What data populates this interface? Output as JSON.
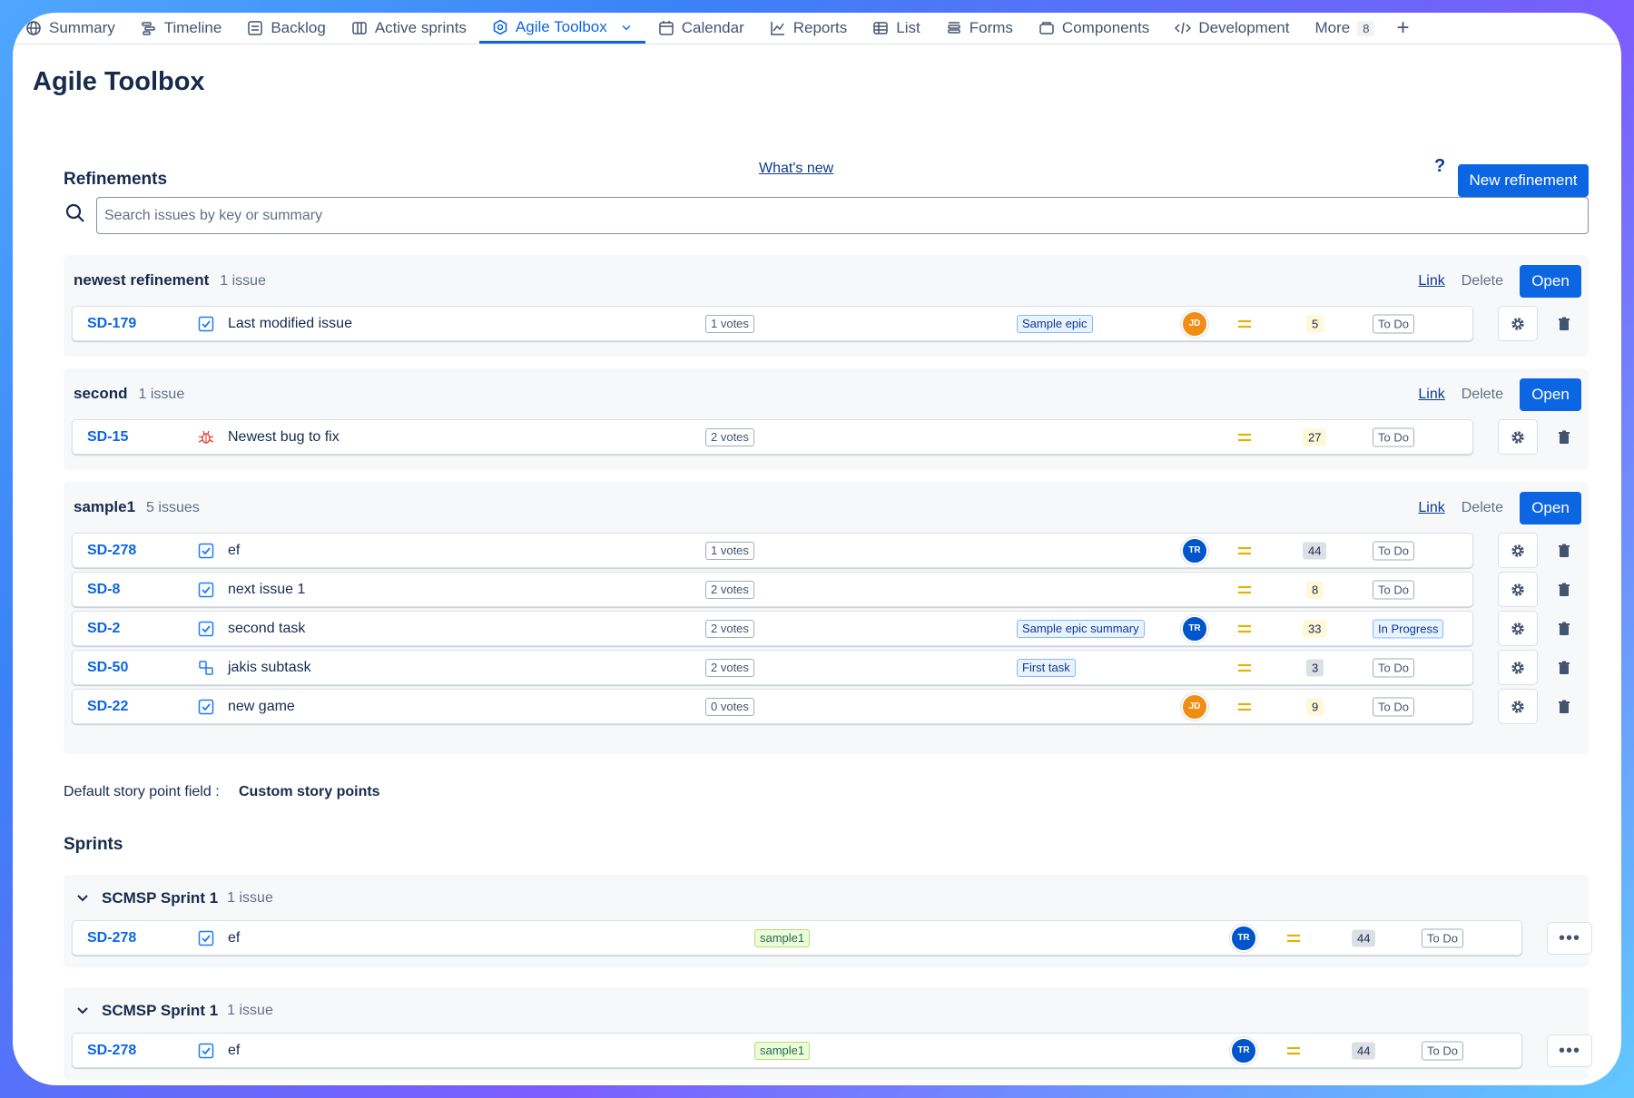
{
  "nav": {
    "tabs": [
      {
        "label": "Summary",
        "icon": "globe-icon"
      },
      {
        "label": "Timeline",
        "icon": "timeline-icon"
      },
      {
        "label": "Backlog",
        "icon": "backlog-icon"
      },
      {
        "label": "Active sprints",
        "icon": "board-icon"
      },
      {
        "label": "Agile Toolbox",
        "icon": "hexagon-icon",
        "active": true
      },
      {
        "label": "Calendar",
        "icon": "calendar-icon"
      },
      {
        "label": "Reports",
        "icon": "chart-icon"
      },
      {
        "label": "List",
        "icon": "list-icon"
      },
      {
        "label": "Forms",
        "icon": "forms-icon"
      },
      {
        "label": "Components",
        "icon": "components-icon"
      },
      {
        "label": "Development",
        "icon": "code-icon"
      }
    ],
    "more_label": "More",
    "more_count": "8",
    "add_label": "+"
  },
  "page": {
    "title": "Agile Toolbox"
  },
  "refinements": {
    "title": "Refinements",
    "whats_new": "What's new",
    "help": "?",
    "new_button": "New refinement",
    "search_placeholder": "Search issues by key or summary",
    "actions": {
      "link": "Link",
      "delete": "Delete",
      "open": "Open"
    },
    "groups": [
      {
        "name": "newest refinement",
        "count": "1 issue",
        "issues": [
          {
            "key": "SD-179",
            "type": "task",
            "summary": "Last modified issue",
            "votes": "1 votes",
            "epic": "Sample epic",
            "avatar": "JD",
            "points": "5",
            "status": "To Do"
          }
        ]
      },
      {
        "name": "second",
        "count": "1 issue",
        "issues": [
          {
            "key": "SD-15",
            "type": "bug",
            "summary": "Newest bug to fix",
            "votes": "2 votes",
            "epic": "",
            "avatar": "",
            "points": "27",
            "status": "To Do"
          }
        ]
      },
      {
        "name": "sample1",
        "count": "5 issues",
        "issues": [
          {
            "key": "SD-278",
            "type": "task",
            "summary": "ef",
            "votes": "1 votes",
            "epic": "",
            "avatar": "TR",
            "points": "44",
            "status": "To Do"
          },
          {
            "key": "SD-8",
            "type": "task",
            "summary": "next issue 1",
            "votes": "2 votes",
            "epic": "",
            "avatar": "",
            "points": "8",
            "status": "To Do"
          },
          {
            "key": "SD-2",
            "type": "task",
            "summary": "second task",
            "votes": "2 votes",
            "epic": "Sample epic summary",
            "avatar": "TR",
            "points": "33",
            "status": "In Progress"
          },
          {
            "key": "SD-50",
            "type": "subtask",
            "summary": "jakis subtask",
            "votes": "2 votes",
            "epic": "First task",
            "avatar": "",
            "points": "3",
            "status": "To Do"
          },
          {
            "key": "SD-22",
            "type": "task",
            "summary": "new game",
            "votes": "0 votes",
            "epic": "",
            "avatar": "JD",
            "points": "9",
            "status": "To Do"
          }
        ]
      }
    ]
  },
  "default_field": {
    "label": "Default story point field :",
    "value": "Custom story points"
  },
  "sprints": {
    "title": "Sprints",
    "groups": [
      {
        "name": "SCMSP Sprint 1",
        "count": "1 issue",
        "issue": {
          "key": "SD-278",
          "summary": "ef",
          "tag": "sample1",
          "avatar": "TR",
          "points": "44",
          "status": "To Do"
        }
      },
      {
        "name": "SCMSP Sprint 1",
        "count": "1 issue",
        "issue": {
          "key": "SD-278",
          "summary": "ef",
          "tag": "sample1",
          "avatar": "TR",
          "points": "44",
          "status": "To Do"
        }
      }
    ]
  },
  "colors": {
    "primary": "#0c66e4",
    "avatar_jd": "#f18d13",
    "avatar_tr": "#0055cc",
    "priority": "#e2b203",
    "bug": "#e2483d"
  }
}
